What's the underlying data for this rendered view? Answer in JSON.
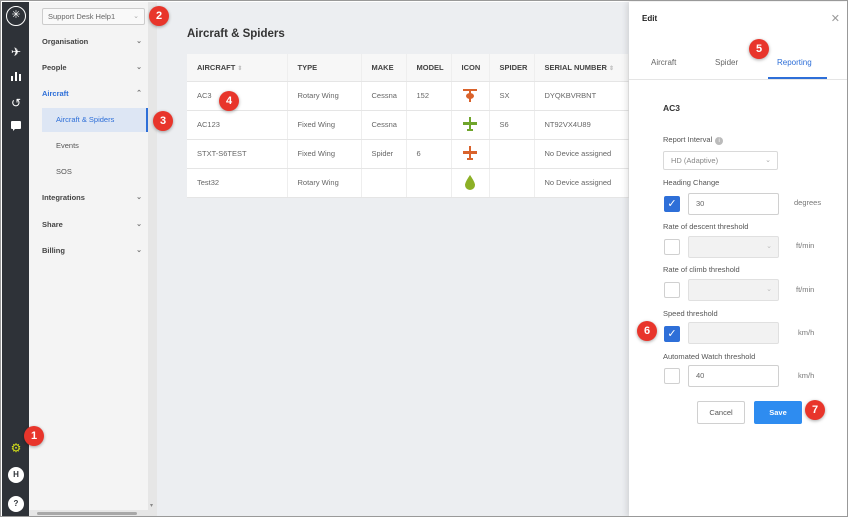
{
  "rail": {
    "icons": [
      "spider-logo-icon",
      "aircraft-icon",
      "chart-icon",
      "history-icon",
      "message-icon",
      "gear-icon",
      "user-avatar",
      "help-icon"
    ],
    "avatar_initial": "H",
    "help_glyph": "?"
  },
  "sidebar": {
    "account_select": "Support Desk Help1",
    "items": [
      {
        "label": "Organisation"
      },
      {
        "label": "People"
      },
      {
        "label": "Aircraft"
      },
      {
        "label": "Integrations"
      },
      {
        "label": "Share"
      },
      {
        "label": "Billing"
      }
    ],
    "subitems": [
      {
        "label": "Aircraft & Spiders"
      },
      {
        "label": "Events"
      },
      {
        "label": "SOS"
      }
    ]
  },
  "main": {
    "title": "Aircraft & Spiders",
    "columns": [
      "AIRCRAFT",
      "TYPE",
      "MAKE",
      "MODEL",
      "ICON",
      "SPIDER",
      "SERIAL NUMBER"
    ],
    "rows": [
      {
        "aircraft": "AC3",
        "type": "Rotary Wing",
        "make": "Cessna",
        "model": "152",
        "icon": "helicopter-orange",
        "spider": "SX",
        "serial": "DYQKBVRBNT"
      },
      {
        "aircraft": "AC123",
        "type": "Fixed Wing",
        "make": "Cessna",
        "model": "",
        "icon": "plane-green",
        "spider": "S6",
        "serial": "NT92VX4U89"
      },
      {
        "aircraft": "STXT-S6TEST",
        "type": "Fixed Wing",
        "make": "Spider",
        "model": "6",
        "icon": "plane-orange",
        "spider": "",
        "serial": "No Device assigned"
      },
      {
        "aircraft": "Test32",
        "type": "Rotary Wing",
        "make": "",
        "model": "",
        "icon": "drop-green",
        "spider": "",
        "serial": "No Device assigned"
      }
    ]
  },
  "panel": {
    "title": "Edit",
    "tabs": [
      "Aircraft",
      "Spider",
      "Reporting"
    ],
    "active_tab": "Reporting",
    "section": "AC3",
    "report_interval_label": "Report Interval",
    "report_interval_value": "HD (Adaptive)",
    "heading_change_label": "Heading Change",
    "heading_change_value": "30",
    "heading_change_unit": "degrees",
    "heading_change_checked": true,
    "descent_label": "Rate of descent threshold",
    "descent_unit": "ft/min",
    "descent_checked": false,
    "climb_label": "Rate of climb threshold",
    "climb_unit": "ft/min",
    "climb_checked": false,
    "speed_label": "Speed threshold",
    "speed_unit": "km/h",
    "speed_checked": true,
    "watch_label": "Automated Watch threshold",
    "watch_value": "40",
    "watch_unit": "km/h",
    "watch_checked": false,
    "cancel_label": "Cancel",
    "save_label": "Save"
  },
  "markers": [
    "1",
    "2",
    "3",
    "4",
    "5",
    "6",
    "7"
  ],
  "colors": {
    "rail": "#2e3238",
    "accent": "#2e6fd8",
    "save": "#2e8cf0",
    "marker": "#e8352b",
    "gear": "#d4e01a"
  }
}
